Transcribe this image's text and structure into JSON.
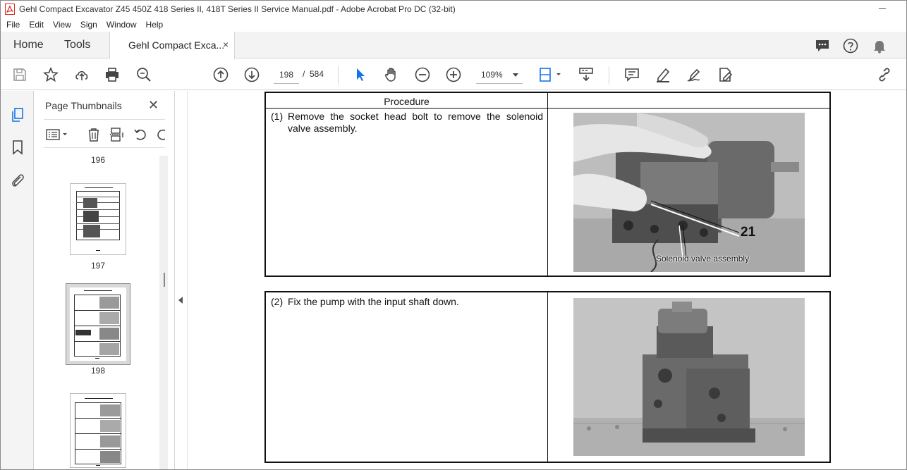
{
  "window": {
    "title": "Gehl Compact Excavator Z45 450Z 418 Series II, 418T Series II Service Manual.pdf - Adobe Acrobat Pro DC (32-bit)"
  },
  "menu": [
    "File",
    "Edit",
    "View",
    "Sign",
    "Window",
    "Help"
  ],
  "tabs": {
    "home": "Home",
    "tools": "Tools",
    "document": "Gehl Compact Exca...",
    "close_glyph": "×"
  },
  "toolbar": {
    "current_page": "198",
    "page_separator": "/",
    "total_pages": "584",
    "zoom": "109%",
    "accent_color": "#1473e6"
  },
  "thumbnail_panel": {
    "title": "Page Thumbnails",
    "close_glyph": "✕",
    "pages": [
      "196",
      "197",
      "198"
    ]
  },
  "document": {
    "column_header": "Procedure",
    "steps": [
      {
        "number": "(1)",
        "text": "Remove the socket head bolt to remove the solenoid valve assembly.",
        "callout_number": "21",
        "callout_label": "Solenoid valve assembly"
      },
      {
        "number": "(2)",
        "text": "Fix the pump with the input shaft down."
      }
    ]
  }
}
